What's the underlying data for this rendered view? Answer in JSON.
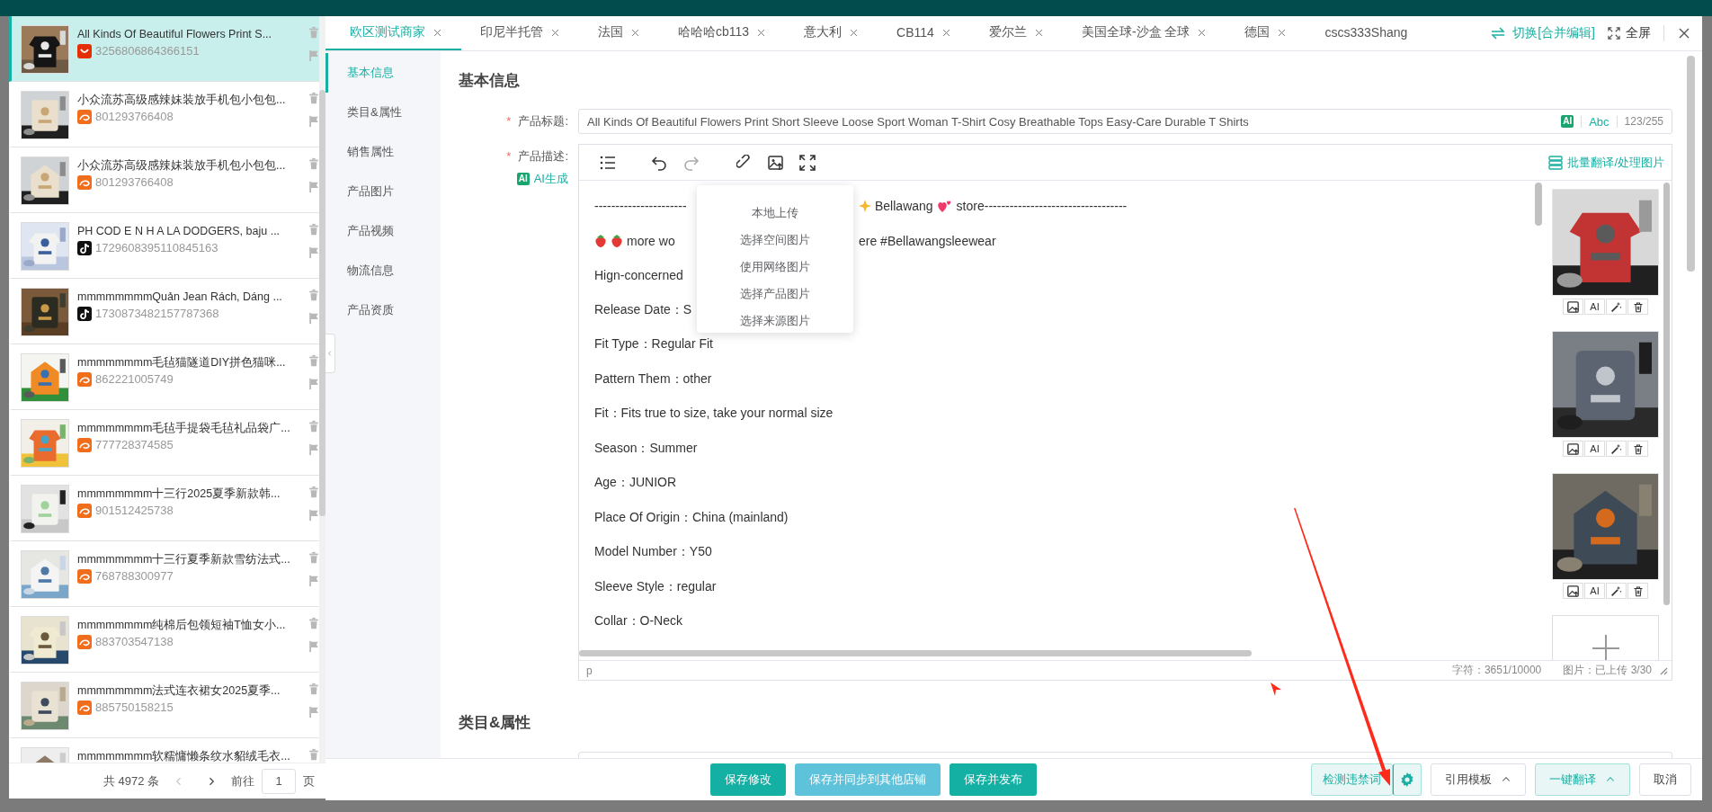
{
  "product_list": {
    "items": [
      {
        "title": "All Kinds Of Beautiful Flowers Print S...",
        "id": "3256806864366151",
        "kind": "smile",
        "selected": true
      },
      {
        "title": "小众流苏高级感辣妹装放手机包小包包...",
        "id": "801293766408",
        "kind": "swirl",
        "selected": false
      },
      {
        "title": "小众流苏高级感辣妹装放手机包小包包...",
        "id": "801293766408",
        "kind": "swirl",
        "selected": false
      },
      {
        "title": "PH COD E N H A LA DODGERS, baju ...",
        "id": "1729608395110845163",
        "kind": "note",
        "selected": false
      },
      {
        "title": "mmmmmmmmQuản Jean Rách, Dáng ...",
        "id": "1730873482157787368",
        "kind": "note",
        "selected": false
      },
      {
        "title": "mmmmmmmm毛毡猫隧道DIY拼色猫咪...",
        "id": "862221005749",
        "kind": "swirl",
        "selected": false
      },
      {
        "title": "mmmmmmmm毛毡手提袋毛毡礼品袋广...",
        "id": "777728374585",
        "kind": "swirl",
        "selected": false
      },
      {
        "title": "mmmmmmmm十三行2025夏季新款韩...",
        "id": "901512425738",
        "kind": "swirl",
        "selected": false
      },
      {
        "title": "mmmmmmmm十三行夏季新款雪纺法式...",
        "id": "768788300977",
        "kind": "swirl",
        "selected": false
      },
      {
        "title": "mmmmmmmm纯棉后包领短袖T恤女小...",
        "id": "883703547138",
        "kind": "swirl",
        "selected": false
      },
      {
        "title": "mmmmmmmm法式连衣裙女2025夏季...",
        "id": "885750158215",
        "kind": "swirl",
        "selected": false
      },
      {
        "title": "mmmmmmmm软糯慵懒条纹水貂绒毛衣...",
        "selected": false
      }
    ],
    "pagination": {
      "total": "共 4972 条",
      "prev_disabled": true,
      "goto": "前往",
      "page": "1",
      "unit": "页"
    }
  },
  "modal": {
    "tabs": [
      {
        "label": "欧区测试商家",
        "selected": true,
        "closable": true
      },
      {
        "label": "印尼半托管",
        "selected": false,
        "closable": true
      },
      {
        "label": "法国",
        "selected": false,
        "closable": true
      },
      {
        "label": "哈哈哈cb113",
        "selected": false,
        "closable": true
      },
      {
        "label": "意大利",
        "selected": false,
        "closable": true
      },
      {
        "label": "CB114",
        "selected": false,
        "closable": true
      },
      {
        "label": "爱尔兰",
        "selected": false,
        "closable": true
      },
      {
        "label": "美国全球-沙盒 全球",
        "selected": false,
        "closable": true
      },
      {
        "label": "德国",
        "selected": false,
        "closable": true
      },
      {
        "label": "cscs333Shang",
        "selected": false,
        "closable": false
      }
    ],
    "switch_mode": "切换[合并编辑]",
    "fullscreen": "全屏",
    "nav": [
      {
        "label": "基本信息",
        "selected": true
      },
      {
        "label": "类目&属性",
        "selected": false
      },
      {
        "label": "销售属性",
        "selected": false
      },
      {
        "label": "产品图片",
        "selected": false
      },
      {
        "label": "产品视频",
        "selected": false
      },
      {
        "label": "物流信息",
        "selected": false
      },
      {
        "label": "产品资质",
        "selected": false
      }
    ],
    "section_title": "基本信息",
    "title_field": {
      "required_mark": "*",
      "label": "产品标题:",
      "value": "All Kinds Of Beautiful Flowers Print Short Sleeve Loose Sport Woman T-Shirt Cosy Breathable Tops Easy-Care Durable T Shirts",
      "ai_badge": "AI",
      "abc": "Abc",
      "count": "123/255"
    },
    "description": {
      "required_mark": "*",
      "label": "产品描述:",
      "ai_badge": "AI",
      "ai_generate": "AI生成",
      "batch_action": "批量翻译/处理图片",
      "lines": [
        {
          "segments": [
            {
              "kind": "text",
              "text": "----------------------"
            }
          ],
          "after_menu": [
            {
              "kind": "sparkle"
            },
            {
              "kind": "text",
              "text": "Bellawang"
            },
            {
              "kind": "hearts"
            },
            {
              "kind": "text",
              "text": "store----------------------------------"
            }
          ]
        },
        {
          "segments": [
            {
              "kind": "berry"
            },
            {
              "kind": "berry"
            },
            {
              "kind": "text",
              "text": "more wo"
            }
          ],
          "after_menu": [
            {
              "kind": "text",
              "text": "ere #Bellawangsleewear"
            }
          ]
        },
        {
          "segments": [
            {
              "kind": "text",
              "text": "Hign-concerned"
            }
          ]
        },
        {
          "segments": [
            {
              "kind": "text",
              "text": "Release Date：S"
            }
          ]
        },
        {
          "segments": [
            {
              "kind": "text",
              "text": "Fit Type：Regular Fit"
            }
          ]
        },
        {
          "segments": [
            {
              "kind": "text",
              "text": "Pattern Them：other"
            }
          ]
        },
        {
          "segments": [
            {
              "kind": "text",
              "text": "Fit：Fits true to size, take your normal size"
            }
          ]
        },
        {
          "segments": [
            {
              "kind": "text",
              "text": "Season：Summer"
            }
          ]
        },
        {
          "segments": [
            {
              "kind": "text",
              "text": "Age：JUNIOR"
            }
          ]
        },
        {
          "segments": [
            {
              "kind": "text",
              "text": "Place Of Origin：China (mainland)"
            }
          ]
        },
        {
          "segments": [
            {
              "kind": "text",
              "text": "Model Number：Y50"
            }
          ]
        },
        {
          "segments": [
            {
              "kind": "text",
              "text": "Sleeve Style：regular"
            }
          ]
        },
        {
          "segments": [
            {
              "kind": "text",
              "text": "Collar：O-Neck"
            }
          ]
        }
      ],
      "upload_menu": [
        "本地上传",
        "选择空间图片",
        "使用网络图片",
        "选择产品图片",
        "选择来源图片"
      ],
      "images": [
        {
          "ai_label": "AI"
        },
        {
          "ai_label": "AI"
        },
        {
          "ai_label": "AI"
        }
      ],
      "element_path": "p",
      "char_count": "字符：3651/10000",
      "image_count": "图片：已上传 3/30"
    },
    "section_2_title": "类目&属性",
    "actions_center": [
      {
        "label": "保存修改",
        "kind": "primary"
      },
      {
        "label": "保存并同步到其他店铺",
        "kind": "secondary"
      },
      {
        "label": "保存并发布",
        "kind": "primary"
      }
    ],
    "actions_right": [
      {
        "label": "检测违禁词",
        "kind": "check"
      },
      {
        "label": "引用模板",
        "kind": "menu"
      },
      {
        "label": "一键翻译",
        "kind": "menu-light"
      },
      {
        "label": "取消",
        "kind": "plain"
      }
    ]
  }
}
